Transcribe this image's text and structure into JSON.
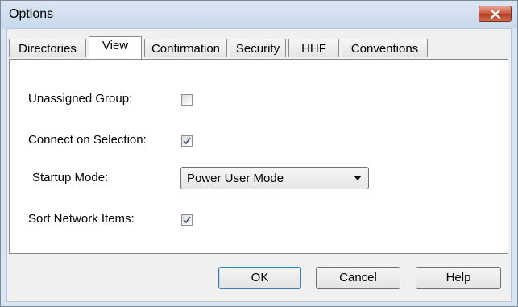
{
  "window": {
    "title": "Options"
  },
  "tabs": [
    {
      "label": "Directories",
      "active": false
    },
    {
      "label": "View",
      "active": true
    },
    {
      "label": "Confirmation",
      "active": false
    },
    {
      "label": "Security",
      "active": false
    },
    {
      "label": "HHF",
      "active": false
    },
    {
      "label": "Conventions",
      "active": false
    }
  ],
  "view": {
    "unassigned_group": {
      "label": "Unassigned Group:",
      "checked": false
    },
    "connect_on_selection": {
      "label": "Connect on Selection:",
      "checked": true
    },
    "startup_mode": {
      "label": "Startup Mode:",
      "selected": "Power User Mode"
    },
    "sort_network_items": {
      "label": "Sort Network Items:",
      "checked": true
    }
  },
  "buttons": {
    "ok": "OK",
    "cancel": "Cancel",
    "help": "Help"
  },
  "colors": {
    "title_bar": "#c9d9ec",
    "close_button": "#c9533a",
    "check_mark": "#4a5b7a",
    "default_button_border": "#3c7fb1"
  }
}
